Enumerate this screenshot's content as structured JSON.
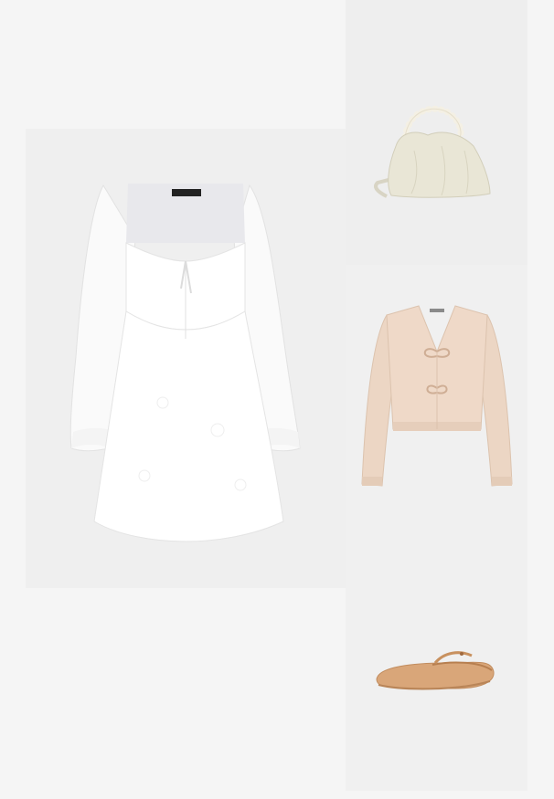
{
  "products": [
    {
      "id": "dress",
      "name": "white-lace-mini-dress",
      "label_text": "gina tricot",
      "color": "#ffffff"
    },
    {
      "id": "bag",
      "name": "cream-pearl-handle-bag",
      "color": "#e9e6d6"
    },
    {
      "id": "cardigan",
      "name": "beige-tie-front-cardigan",
      "color": "#efd9c8"
    },
    {
      "id": "flats",
      "name": "tan-mary-jane-flats",
      "color": "#d9a679"
    }
  ]
}
